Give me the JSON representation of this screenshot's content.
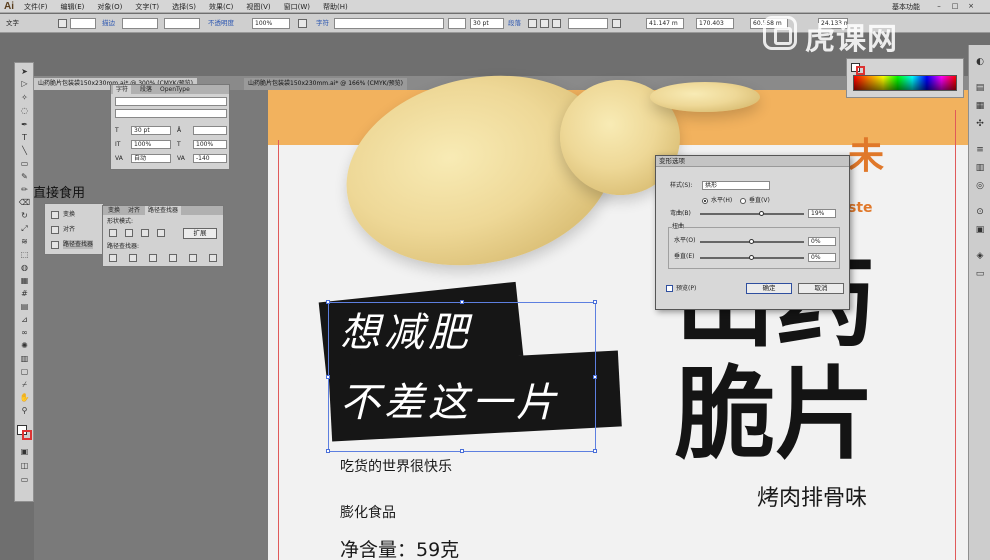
{
  "app": {
    "logo": "Ai",
    "workspace": "基本功能"
  },
  "menu": {
    "items": [
      "文件(F)",
      "编辑(E)",
      "对象(O)",
      "文字(T)",
      "选择(S)",
      "效果(C)",
      "视图(V)",
      "窗口(W)",
      "帮助(H)"
    ]
  },
  "controlbar": {
    "type_label": "文字",
    "opacity_link": "描边",
    "opacity_value": "100%",
    "opacity_label": "不透明度",
    "char_link": "字符",
    "font_size": "30 pt",
    "para_link": "段落",
    "x_value": "41.147 m",
    "y_value": "170.403",
    "w_value": "60.558 m",
    "h_value": "24.133 m"
  },
  "watermark": {
    "text": "虎课网"
  },
  "doc_tabs": [
    {
      "label": "山药脆片包装袋150x230mm.ai* @ 300% (CMYK/预览)"
    },
    {
      "label": "山药脆片包装袋150x230mm.ai* @ 166% (CMYK/预览)"
    }
  ],
  "char_panel": {
    "tabs": [
      "字符",
      "段落",
      "OpenType"
    ],
    "font_size": "30 pt",
    "leading": "",
    "h_scale": "100%",
    "v_scale": "100%",
    "kerning": "自动",
    "tracking": "-140"
  },
  "transform_panel": {
    "tabs": [
      "变换",
      "对齐",
      "路径查找器"
    ],
    "items": [
      "变换",
      "对齐",
      "路径查找器"
    ],
    "shape_mode_label": "形状模式:",
    "pathfinder_label": "路径查找器:",
    "expand_button": "扩展"
  },
  "warp_dialog": {
    "title": "变形选项",
    "style_label": "样式(S):",
    "style_value": "拱形",
    "horizontal_radio": "水平(H)",
    "vertical_radio": "垂直(V)",
    "bend_label": "弯曲(B)",
    "bend_value": "19%",
    "bend_fraction": 0.595,
    "distortion_label": "扭曲",
    "dist_h_label": "水平(O)",
    "dist_h_value": "0%",
    "dist_v_label": "垂直(E)",
    "dist_v_value": "0%",
    "preview_label": "预览(P)",
    "ok_button": "确定",
    "cancel_button": "取消"
  },
  "canvas_overlay_text": "直接食用",
  "poster": {
    "brand_char": "未",
    "brand_sub": "ste",
    "title_line1": "山药",
    "title_line2": "脆片",
    "flavor": "烤肉排骨味",
    "slogan_line1": "想减肥",
    "slogan_line2": "不差这一片",
    "tagline": "吃货的世界很快乐",
    "category": "膨化食品",
    "net_weight": "净含量：59克"
  }
}
